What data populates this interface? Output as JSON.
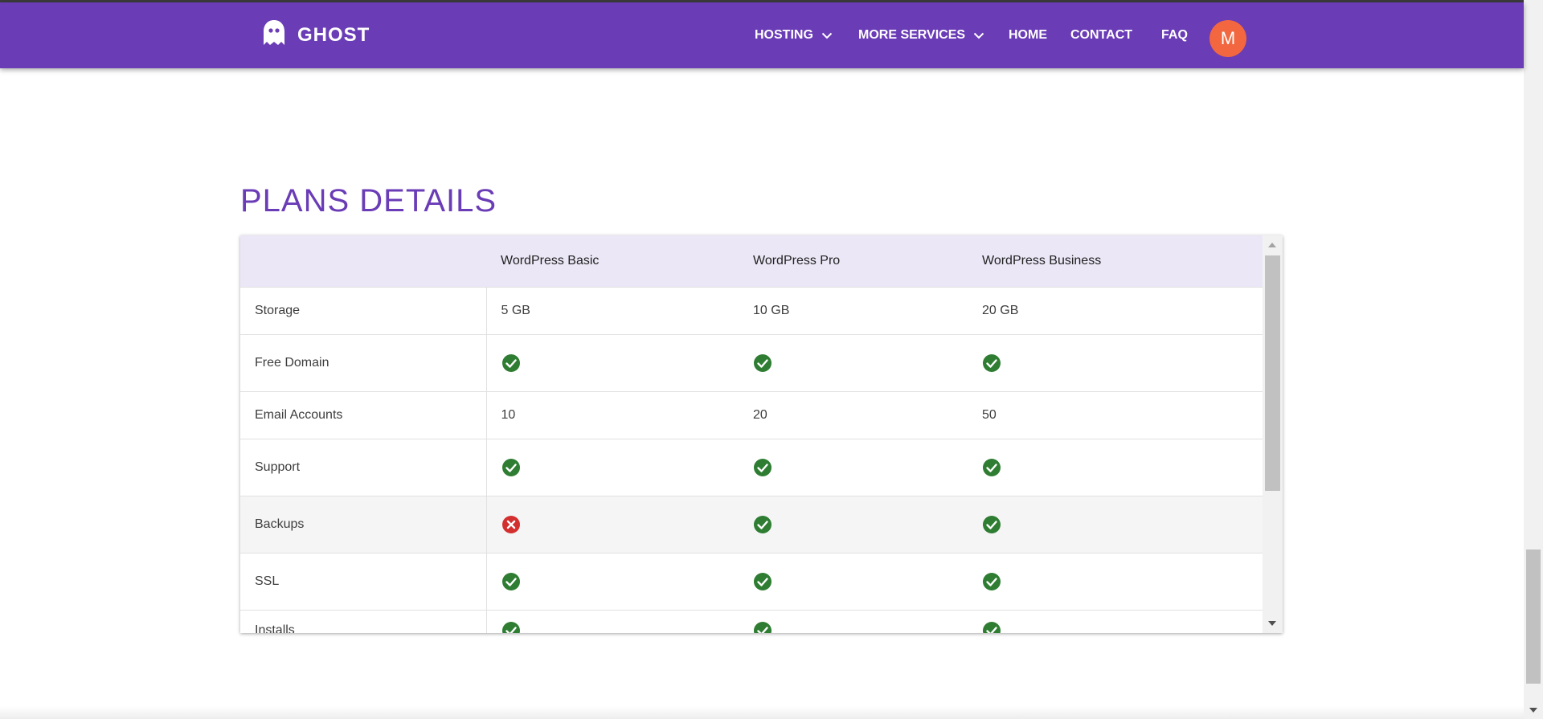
{
  "navbar": {
    "brand": "GHOST",
    "brand_icon": "ghost-icon",
    "items": [
      {
        "label": "HOSTING",
        "dropdown": true
      },
      {
        "label": "MORE SERVICES",
        "dropdown": true
      },
      {
        "label": "HOME",
        "dropdown": false
      },
      {
        "label": "CONTACT",
        "dropdown": false
      },
      {
        "label": "FAQ",
        "dropdown": false
      }
    ],
    "avatar_initial": "M",
    "colors": {
      "background": "#6a3cb6",
      "avatar": "#f2673f"
    }
  },
  "section": {
    "title": "PLANS DETAILS"
  },
  "table": {
    "headers": [
      "",
      "WordPress Basic",
      "WordPress Pro",
      "WordPress Business"
    ],
    "rows": [
      {
        "label": "Storage",
        "cells": [
          {
            "type": "text",
            "value": "5 GB"
          },
          {
            "type": "text",
            "value": "10 GB"
          },
          {
            "type": "text",
            "value": "20 GB"
          }
        ]
      },
      {
        "label": "Free Domain",
        "cells": [
          {
            "type": "icon",
            "value": "check-icon"
          },
          {
            "type": "icon",
            "value": "check-icon"
          },
          {
            "type": "icon",
            "value": "check-icon"
          }
        ]
      },
      {
        "label": "Email Accounts",
        "cells": [
          {
            "type": "text",
            "value": "10"
          },
          {
            "type": "text",
            "value": "20"
          },
          {
            "type": "text",
            "value": "50"
          }
        ]
      },
      {
        "label": "Support",
        "cells": [
          {
            "type": "icon",
            "value": "check-icon"
          },
          {
            "type": "icon",
            "value": "check-icon"
          },
          {
            "type": "icon",
            "value": "check-icon"
          }
        ]
      },
      {
        "label": "Backups",
        "cells": [
          {
            "type": "icon",
            "value": "cross-icon"
          },
          {
            "type": "icon",
            "value": "check-icon"
          },
          {
            "type": "icon",
            "value": "check-icon"
          }
        ]
      },
      {
        "label": "SSL",
        "cells": [
          {
            "type": "icon",
            "value": "check-icon"
          },
          {
            "type": "icon",
            "value": "check-icon"
          },
          {
            "type": "icon",
            "value": "check-icon"
          }
        ]
      },
      {
        "label": "Installs",
        "cells": [
          {
            "type": "icon",
            "value": "check-icon"
          },
          {
            "type": "icon",
            "value": "check-icon"
          },
          {
            "type": "icon",
            "value": "check-icon"
          }
        ]
      }
    ],
    "colors": {
      "title": "#6a3cb6",
      "header_bg": "#ebe7f6",
      "check": "#2e7d32",
      "cross": "#d32f2f"
    }
  }
}
